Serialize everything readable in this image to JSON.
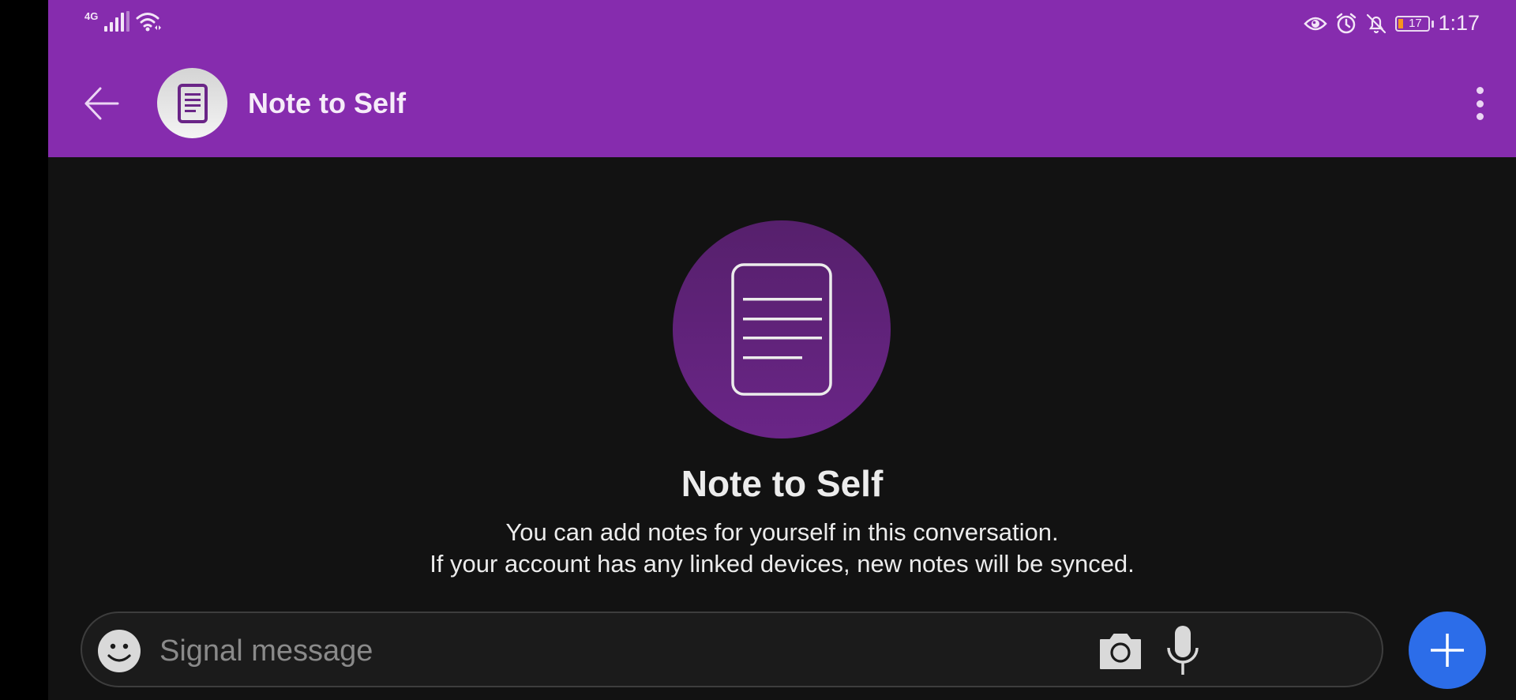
{
  "status_bar": {
    "network_type": "4G",
    "signal_icon": "cell-signal-icon",
    "wifi_icon": "wifi-icon",
    "right_icons": [
      "eye-icon",
      "alarm-clock-icon",
      "bell-off-icon"
    ],
    "battery_level": "17",
    "battery_color": "#F7941D",
    "time": "1:17"
  },
  "app_bar": {
    "back_icon": "arrow-left-icon",
    "avatar_icon": "note-document-icon",
    "title": "Note to Self",
    "menu_icon": "more-vertical-icon",
    "color": "#862CAE"
  },
  "conversation_header": {
    "icon": "note-document-icon",
    "title": "Note to Self",
    "description_line1": "You can add notes for yourself in this conversation.",
    "description_line2": "If your account has any linked devices, new notes will be synced."
  },
  "composer": {
    "emoji_icon": "smiley-icon",
    "placeholder": "Signal message",
    "value": "",
    "camera_icon": "camera-icon",
    "mic_icon": "microphone-icon",
    "attach_icon": "plus-icon",
    "attach_color": "#2C6DE9"
  }
}
